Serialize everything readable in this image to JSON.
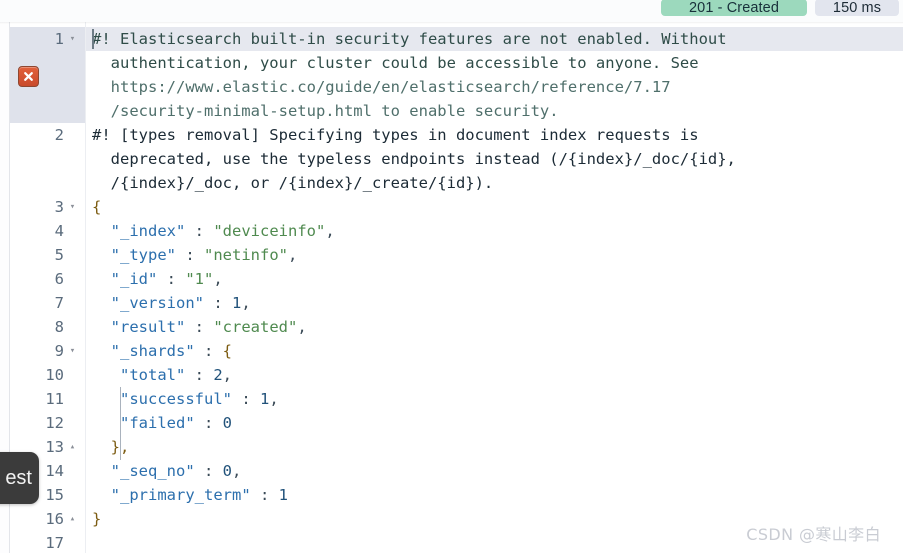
{
  "topbar": {
    "status_badge": "201 - Created",
    "time_badge": "150 ms",
    "status_color": "#9cd9bd",
    "time_color": "#e2e5ee"
  },
  "gutter": {
    "error_icon": "error-x-icon",
    "lines": [
      {
        "num": "1",
        "fold": "▾",
        "highlighted": true
      },
      {
        "num": "2",
        "fold": "",
        "highlighted": false
      },
      {
        "num": "3",
        "fold": "▾",
        "highlighted": false
      },
      {
        "num": "4",
        "fold": "",
        "highlighted": false
      },
      {
        "num": "5",
        "fold": "",
        "highlighted": false
      },
      {
        "num": "6",
        "fold": "",
        "highlighted": false
      },
      {
        "num": "7",
        "fold": "",
        "highlighted": false
      },
      {
        "num": "8",
        "fold": "",
        "highlighted": false
      },
      {
        "num": "9",
        "fold": "▾",
        "highlighted": false
      },
      {
        "num": "10",
        "fold": "",
        "highlighted": false
      },
      {
        "num": "11",
        "fold": "",
        "highlighted": false
      },
      {
        "num": "12",
        "fold": "",
        "highlighted": false
      },
      {
        "num": "13",
        "fold": "▴",
        "highlighted": false
      },
      {
        "num": "14",
        "fold": "",
        "highlighted": false
      },
      {
        "num": "15",
        "fold": "",
        "highlighted": false
      },
      {
        "num": "16",
        "fold": "▴",
        "highlighted": false
      },
      {
        "num": "17",
        "fold": "",
        "highlighted": false
      }
    ]
  },
  "code": {
    "warning_1": {
      "row_a": "#! Elasticsearch built-in security features are not enabled. Without",
      "row_b": "  authentication, your cluster could be accessible to anyone. See",
      "row_c": "  https://www.elastic.co/guide/en/elasticsearch/reference/7.17",
      "row_d": "  /security-minimal-setup.html to enable security."
    },
    "warning_2": {
      "row_a": "#! [types removal] Specifying types in document index requests is",
      "row_b": "  deprecated, use the typeless endpoints instead (/{index}/_doc/{id},",
      "row_c": "  /{index}/_doc, or /{index}/_create/{id})."
    },
    "json": {
      "open_brace": "{",
      "index_key": "\"_index\"",
      "index_sep": " : ",
      "index_val": "\"deviceinfo\"",
      "index_comma": ",",
      "type_key": "\"_type\"",
      "type_sep": " : ",
      "type_val": "\"netinfo\"",
      "type_comma": ",",
      "id_key": "\"_id\"",
      "id_sep": " : ",
      "id_val": "\"1\"",
      "id_comma": ",",
      "version_key": "\"_version\"",
      "version_sep": " : ",
      "version_val": "1",
      "version_comma": ",",
      "result_key": "\"result\"",
      "result_sep": " : ",
      "result_val": "\"created\"",
      "result_comma": ",",
      "shards_key": "\"_shards\"",
      "shards_sep": " : ",
      "shards_open": "{",
      "total_key": "\"total\"",
      "total_sep": " : ",
      "total_val": "2",
      "total_comma": ",",
      "successful_key": "\"successful\"",
      "successful_sep": " : ",
      "successful_val": "1",
      "successful_comma": ",",
      "failed_key": "\"failed\"",
      "failed_sep": " : ",
      "failed_val": "0",
      "shards_close": "},",
      "seq_no_key": "\"_seq_no\"",
      "seq_no_sep": " : ",
      "seq_no_val": "0",
      "seq_no_comma": ",",
      "primary_term_key": "\"_primary_term\"",
      "primary_term_sep": " : ",
      "primary_term_val": "1",
      "close_brace": "}"
    }
  },
  "tooltip": {
    "label": "est"
  },
  "watermark": {
    "text": "CSDN @寒山李白"
  }
}
